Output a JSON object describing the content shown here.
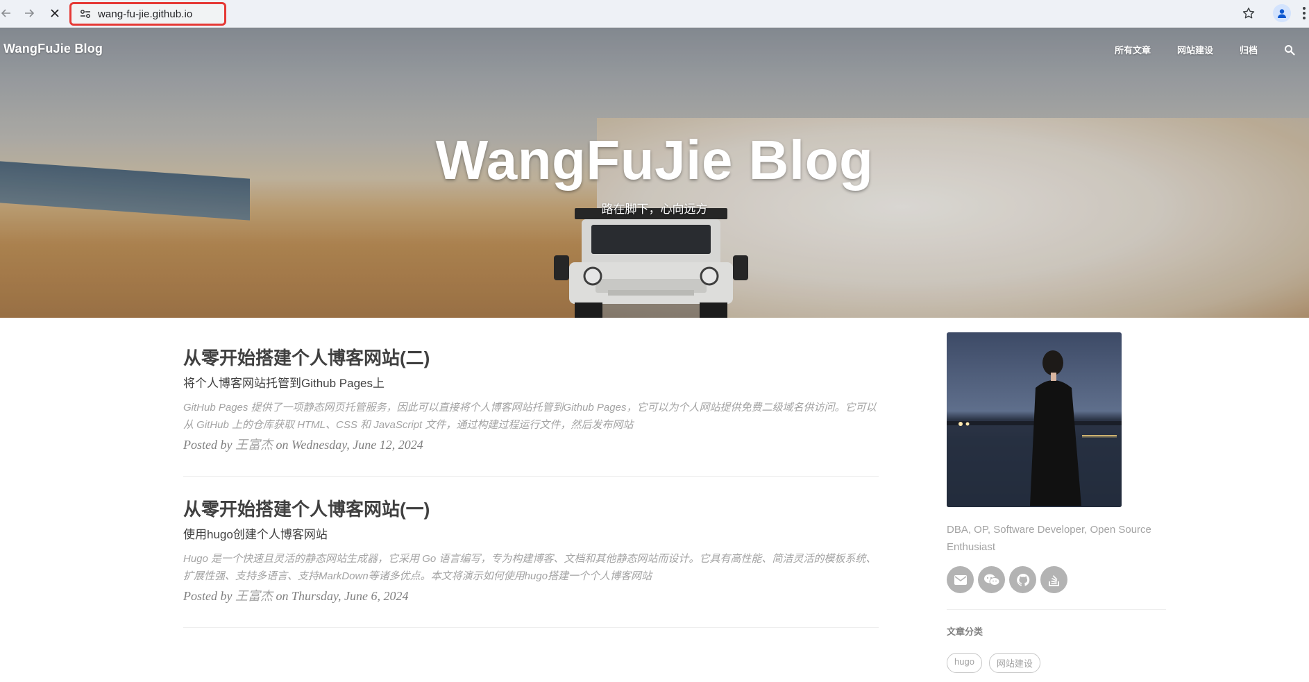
{
  "browser": {
    "url": "wang-fu-jie.github.io"
  },
  "site": {
    "brand": "WangFuJie Blog",
    "nav": [
      "所有文章",
      "网站建设",
      "归档"
    ],
    "hero_title": "WangFuJie Blog",
    "hero_subtitle": "路在脚下，心向远方"
  },
  "posts": [
    {
      "title": "从零开始搭建个人博客网站(二)",
      "subtitle": "将个人博客网站托管到Github Pages上",
      "excerpt": "GitHub Pages 提供了一项静态网页托管服务，因此可以直接将个人博客网站托管到Github Pages，它可以为个人网站提供免费二级域名供访问。它可以从 GitHub 上的仓库获取 HTML、CSS 和 JavaScript 文件，通过构建过程运行文件，然后发布网站",
      "posted_by": "Posted by",
      "author": "王富杰",
      "date": "on Wednesday, June 12, 2024"
    },
    {
      "title": "从零开始搭建个人博客网站(一)",
      "subtitle": "使用hugo创建个人博客网站",
      "excerpt": "Hugo 是一个快速且灵活的静态网站生成器，它采用 Go 语言编写，专为构建博客、文档和其他静态网站而设计。它具有高性能、简洁灵活的模板系统、扩展性强、支持多语言、支持MarkDown等诸多优点。本文将演示如何使用hugo搭建一个个人博客网站",
      "posted_by": "Posted by",
      "author": "王富杰",
      "date": "on Thursday, June 6, 2024"
    }
  ],
  "sidebar": {
    "bio": "DBA, OP, Software Developer, Open Source Enthusiast",
    "social_icons": [
      "email-icon",
      "wechat-icon",
      "github-icon",
      "stackoverflow-icon"
    ],
    "categories_title": "文章分类",
    "tags": [
      "hugo",
      "网站建设"
    ]
  },
  "colors": {
    "text": "#404040",
    "muted": "#a3a3a3",
    "social_bg": "#b3b3b3",
    "url_highlight": "#e53935"
  }
}
